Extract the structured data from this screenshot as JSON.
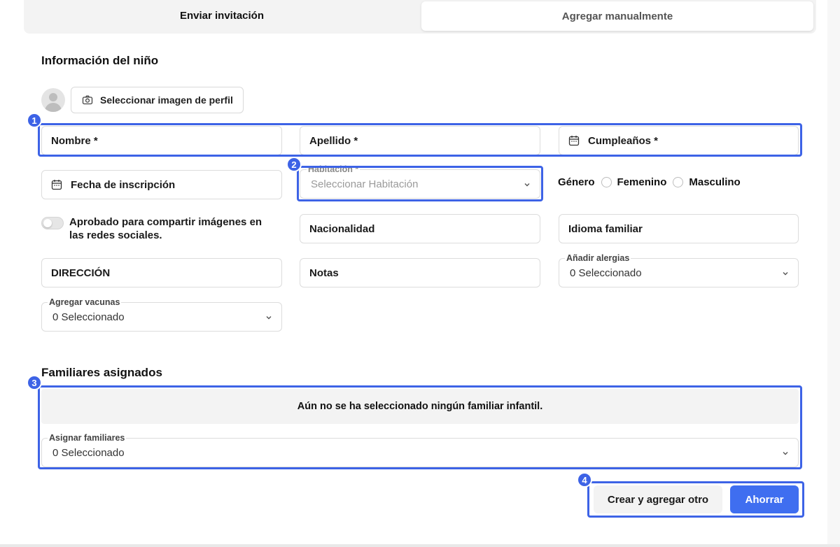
{
  "tabs": [
    {
      "label": "Enviar invitación",
      "active": false
    },
    {
      "label": "Agregar manualmente",
      "active": true
    }
  ],
  "child_section": {
    "title": "Información del niño",
    "profile_image_button": "Seleccionar imagen de perfil",
    "fields": {
      "first_name": "Nombre *",
      "last_name": "Apellido *",
      "birthday": "Cumpleaños *",
      "enrollment_date": "Fecha de inscripción",
      "room_label": "Habitación *",
      "room_placeholder": "Seleccionar Habitación",
      "gender_label": "Género",
      "gender_female": "Femenino",
      "gender_male": "Masculino",
      "social_consent": "Aprobado para compartir imágenes en las redes sociales.",
      "nationality": "Nacionalidad",
      "home_language": "Idioma familiar",
      "address": "DIRECCIÓN",
      "notes": "Notas",
      "allergies_label": "Añadir alergias",
      "allergies_value": "0 Seleccionado",
      "vaccines_label": "Agregar vacunas",
      "vaccines_value": "0 Seleccionado"
    }
  },
  "family_section": {
    "title": "Familiares asignados",
    "empty_message": "Aún no se ha seleccionado ningún familiar infantil.",
    "assign_label": "Asignar familiares",
    "assign_value": "0 Seleccionado"
  },
  "actions": {
    "create_and_add": "Crear y agregar otro",
    "save": "Ahorrar"
  },
  "annotations": [
    "1",
    "2",
    "3",
    "4"
  ],
  "colors": {
    "accent": "#3d63e6",
    "primary_button": "#3f6ef0",
    "muted_bg": "#f3f3f3",
    "border": "#dcdcdc"
  },
  "icons": {
    "camera": "camera-icon",
    "calendar": "calendar-icon",
    "chevron": "chevron-down-icon",
    "avatar": "user-avatar-icon"
  }
}
